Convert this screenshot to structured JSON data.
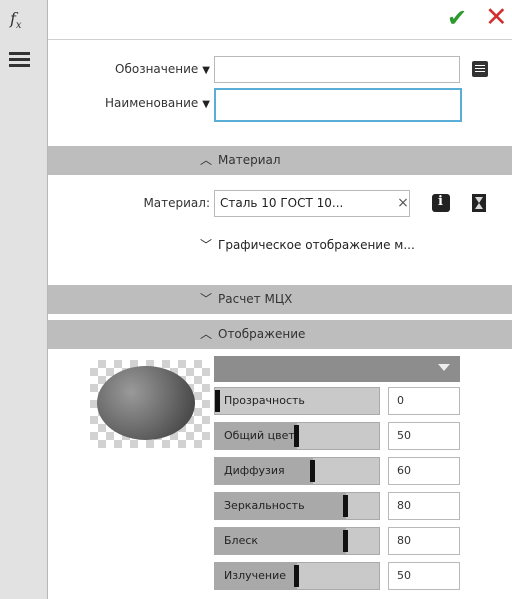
{
  "header": {
    "fx_label": "f",
    "fx_sub": "x"
  },
  "designation": {
    "label": "Обозначение",
    "value": ""
  },
  "name": {
    "label": "Наименование",
    "value": ""
  },
  "sections": {
    "material": "Материал",
    "graphic": "Графическое отображение м...",
    "mcx": "Расчет МЦХ",
    "display": "Отображение"
  },
  "material": {
    "label": "Материал:",
    "value": "Сталь 10 ГОСТ 10...",
    "clear": "×"
  },
  "display": {
    "properties": [
      {
        "name": "Прозрачность",
        "value": "0",
        "level": 0.0
      },
      {
        "name": "Общий цвет",
        "value": "50",
        "level": 0.5
      },
      {
        "name": "Диффузия",
        "value": "60",
        "level": 0.6
      },
      {
        "name": "Зеркальность",
        "value": "80",
        "level": 0.8
      },
      {
        "name": "Блеск",
        "value": "80",
        "level": 0.8
      },
      {
        "name": "Излучение",
        "value": "50",
        "level": 0.5
      }
    ]
  },
  "icons": {
    "fx": "fx-icon",
    "menu": "hamburger-icon",
    "confirm": "check-icon",
    "cancel": "close-icon",
    "doc": "document-icon",
    "library": "library-icon",
    "hourglass": "hourglass-icon"
  },
  "colors": {
    "confirm": "#2e9a2e",
    "cancel": "#d23030",
    "section": "#bdbdbd",
    "focus": "#5aaed6"
  }
}
